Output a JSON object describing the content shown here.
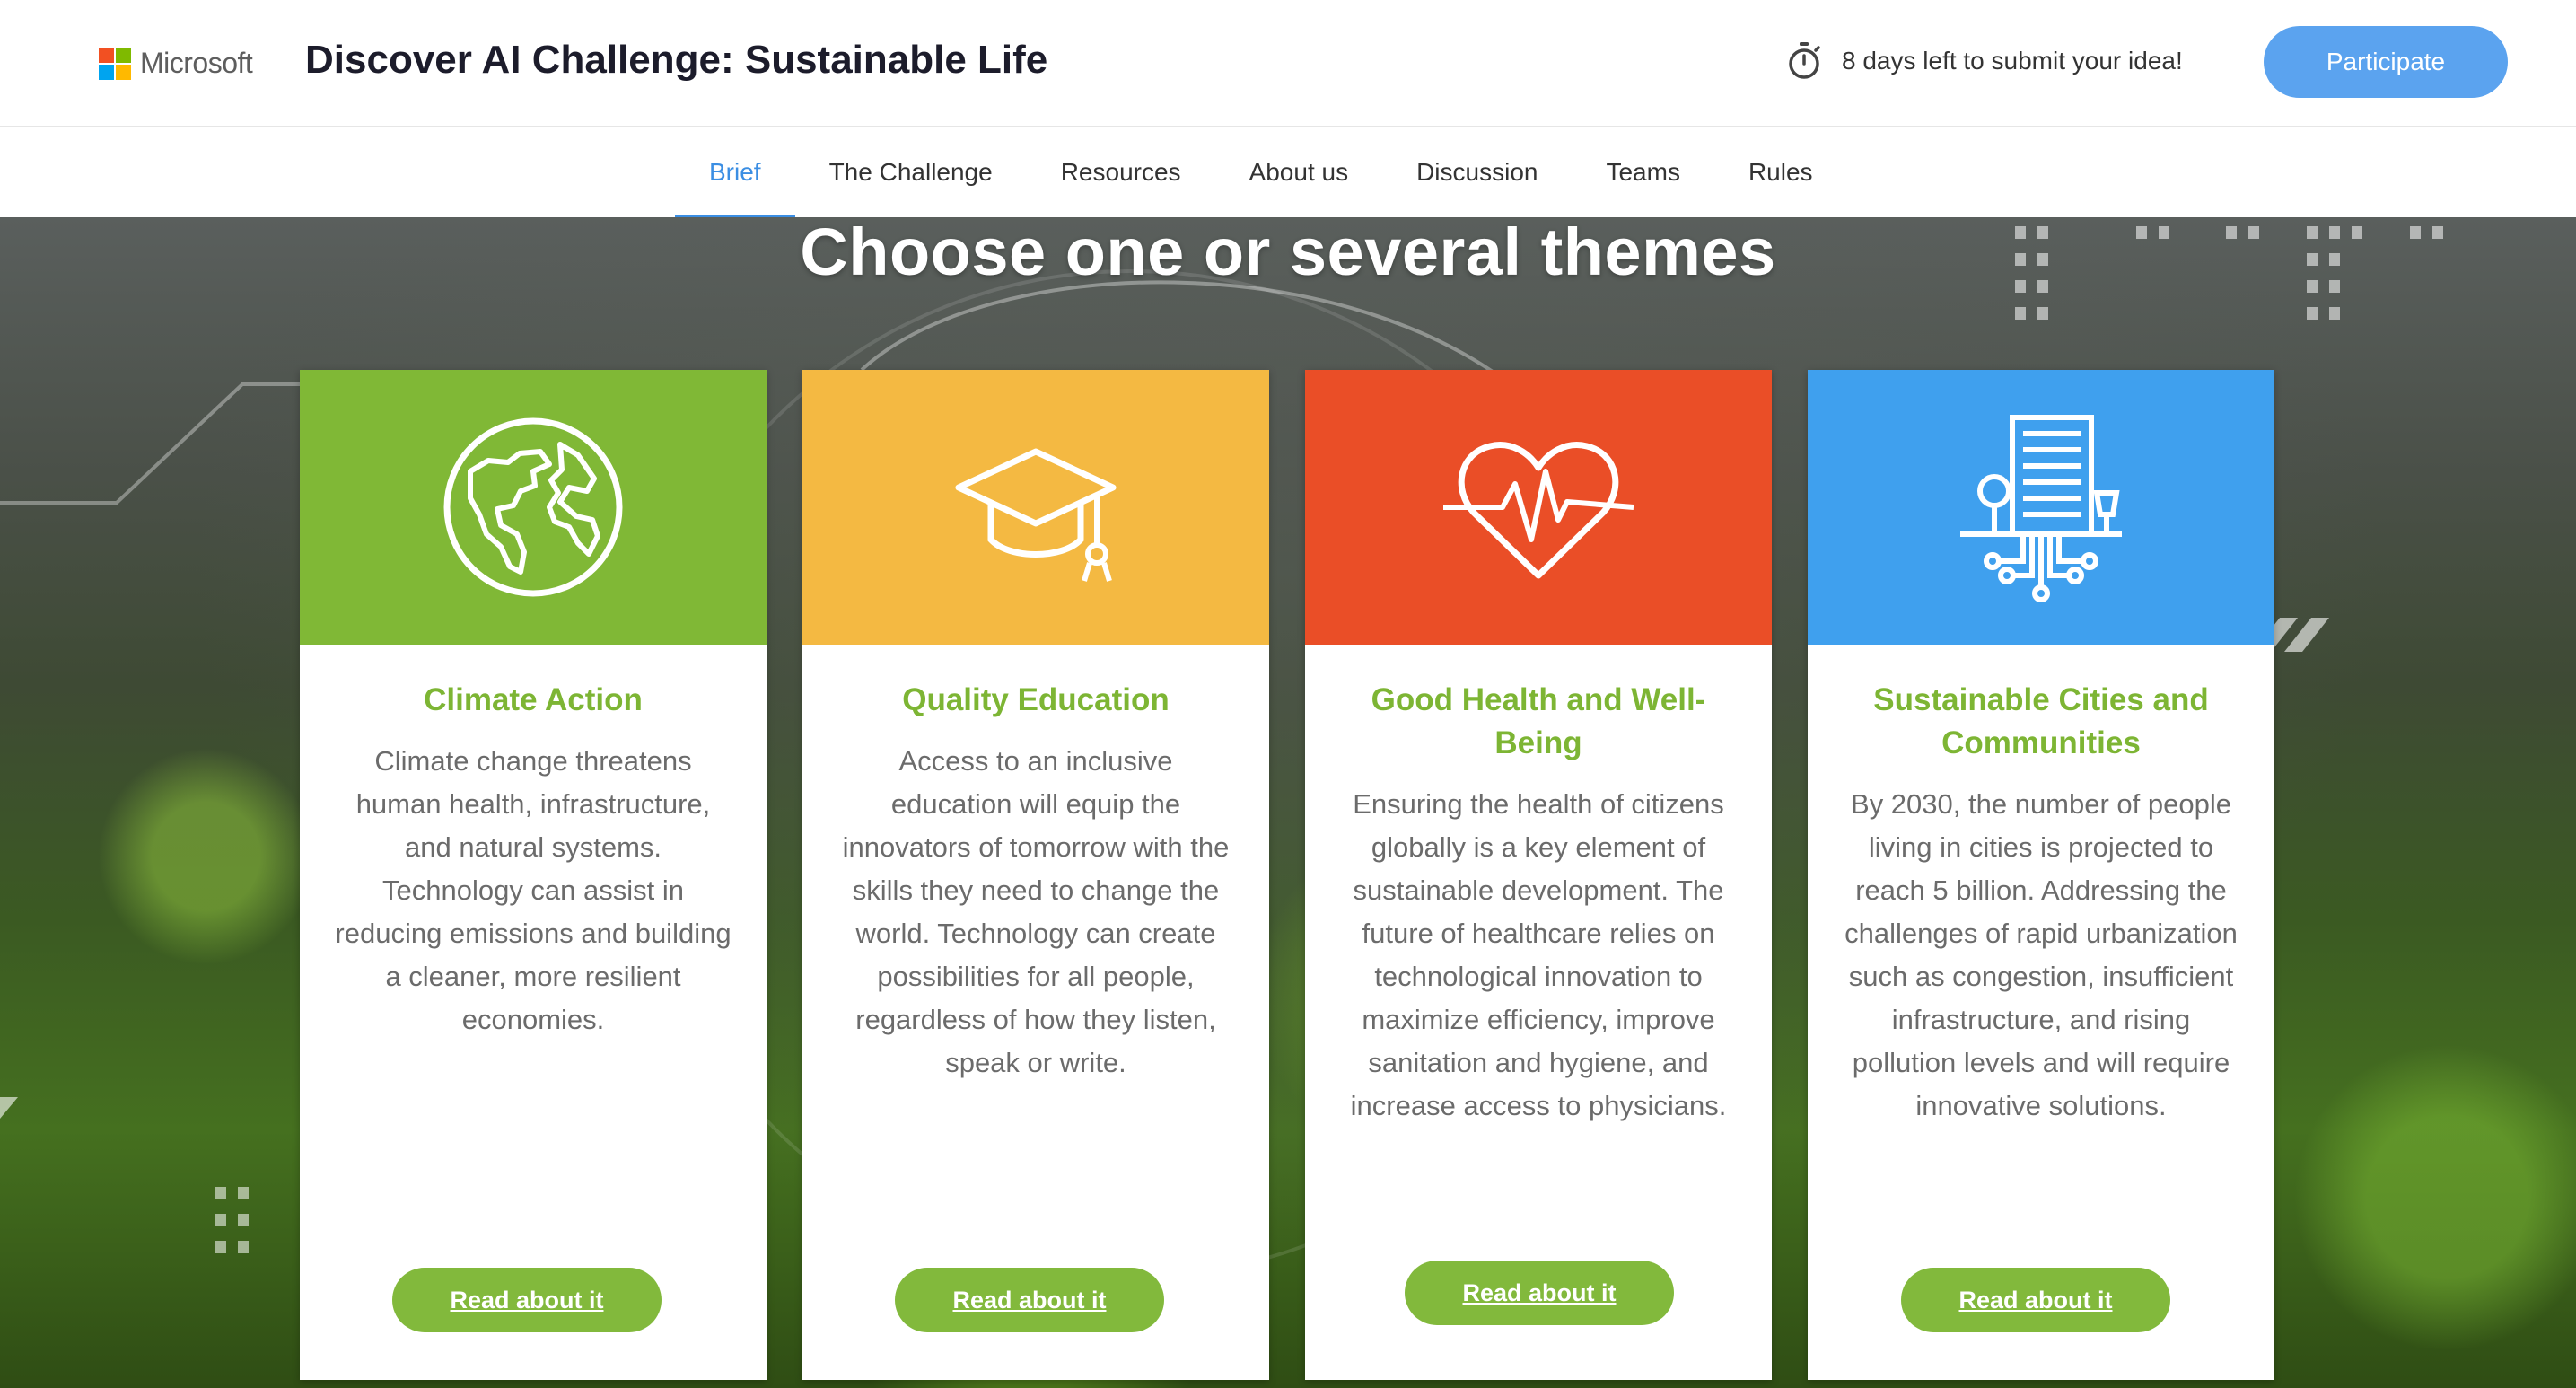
{
  "header": {
    "brand": "Microsoft",
    "title": "Discover AI Challenge: Sustainable Life",
    "deadline_text": "8 days left to submit your idea!",
    "participate_label": "Participate"
  },
  "nav": {
    "items": [
      {
        "label": "Brief",
        "active": true
      },
      {
        "label": "The Challenge"
      },
      {
        "label": "Resources"
      },
      {
        "label": "About us"
      },
      {
        "label": "Discussion"
      },
      {
        "label": "Teams"
      },
      {
        "label": "Rules"
      }
    ]
  },
  "hero": {
    "heading": "Choose one or several themes"
  },
  "cards": [
    {
      "title": "Climate Action",
      "icon": "globe-icon",
      "color": "#80b836",
      "description": "Climate change threatens human health, infrastructure, and natural systems. Technology can assist in reducing emissions and building a cleaner, more resilient economies.",
      "button": "Read about it"
    },
    {
      "title": "Quality Education",
      "icon": "graduation-cap-icon",
      "color": "#f4b942",
      "description": "Access to an inclusive education will equip the innovators of tomorrow with the skills they need to change the world. Technology can create possibilities for all people, regardless of how they listen, speak or write.",
      "button": "Read about it"
    },
    {
      "title": "Good Health and Well-Being",
      "icon": "heartbeat-icon",
      "color": "#ea4e27",
      "description": "Ensuring the health of citizens globally is a key element of sustainable development. The future of healthcare relies on technological innovation to maximize efficiency, improve sanitation and hygiene, and increase access to physicians.",
      "button": "Read about it"
    },
    {
      "title": "Sustainable Cities and Communities",
      "icon": "smart-city-icon",
      "color": "#3fa0ee",
      "description": "By 2030, the number of people living in cities is projected to reach 5 billion. Addressing the challenges of rapid urbanization such as congestion, insufficient infrastructure, and rising pollution levels and will require innovative solutions.",
      "button": "Read about it"
    }
  ]
}
